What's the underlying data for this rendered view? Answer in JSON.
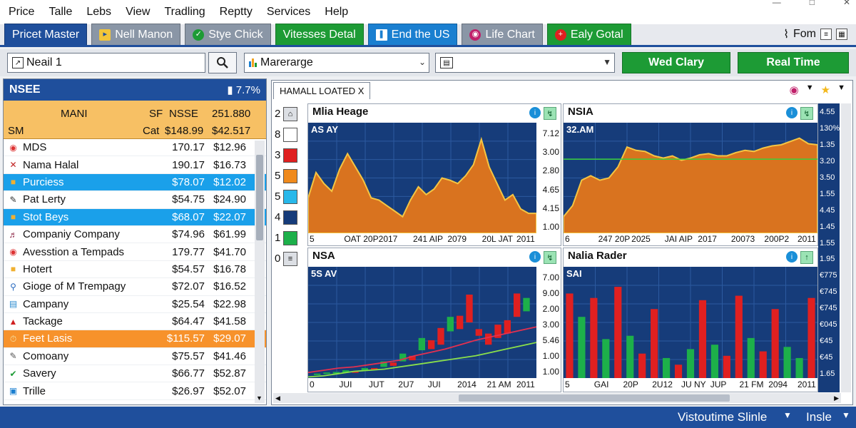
{
  "menu": [
    "Price",
    "Talle",
    "Lebs",
    "View",
    "Tradling",
    "Reptty",
    "Services",
    "Help"
  ],
  "tabs": [
    {
      "label": "Pricet Master",
      "style": "blue",
      "icon": ""
    },
    {
      "label": "Nell Manon",
      "style": "gray",
      "icon": "tag-icon"
    },
    {
      "label": "Stye Chick",
      "style": "gray",
      "icon": "check-circle-icon"
    },
    {
      "label": "Vitesses Detal",
      "style": "green",
      "icon": ""
    },
    {
      "label": "End the US",
      "style": "lblue",
      "icon": "columns-icon"
    },
    {
      "label": "Life Chart",
      "style": "gray",
      "icon": "globe-icon"
    },
    {
      "label": "Ealy Gotal",
      "style": "green",
      "icon": "plus-icon"
    }
  ],
  "tabbar_right": {
    "label": "Fom"
  },
  "toolbar": {
    "symbol_value": "Neail 1",
    "market_value": "Marerarge",
    "third_value": "",
    "btn1": "Wed Clary",
    "btn2": "Real Time"
  },
  "left_panel": {
    "title": "NSEE",
    "percent": "7.7%",
    "header1": {
      "name": "MANI",
      "c1": "SF",
      "c2": "NSSE",
      "c3": "251.880"
    },
    "header2": {
      "name": "SM",
      "c1": "Cat",
      "c2": "$148.99",
      "c3": "$42.517"
    },
    "rows": [
      {
        "name": "MDS",
        "v1": "170.17",
        "v2": "$12.96",
        "icon": "chrome-icon",
        "sel": ""
      },
      {
        "name": "Nama Halal",
        "v1": "190.17",
        "v2": "$16.73",
        "icon": "x-icon",
        "sel": ""
      },
      {
        "name": "Purciess",
        "v1": "$78.07",
        "v2": "$12.02",
        "icon": "folder-icon",
        "sel": "blue"
      },
      {
        "name": "Pat Lerty",
        "v1": "$54.75",
        "v2": "$24.90",
        "icon": "pencil-icon",
        "sel": ""
      },
      {
        "name": "Stot Beys",
        "v1": "$68.07",
        "v2": "$22.07",
        "icon": "folder-icon",
        "sel": "blue"
      },
      {
        "name": "Companiy Company",
        "v1": "$74.96",
        "v2": "$61.99",
        "icon": "music-icon",
        "sel": ""
      },
      {
        "name": "Avesstion a Tempads",
        "v1": "179.77",
        "v2": "$41.70",
        "icon": "chrome-icon",
        "sel": ""
      },
      {
        "name": "Hotert",
        "v1": "$54.57",
        "v2": "$16.78",
        "icon": "folder-icon",
        "sel": ""
      },
      {
        "name": "Gioge of M Trempagy",
        "v1": "$72.07",
        "v2": "$16.52",
        "icon": "search-icon",
        "sel": ""
      },
      {
        "name": "Campany",
        "v1": "$25.54",
        "v2": "$22.98",
        "icon": "document-icon",
        "sel": ""
      },
      {
        "name": "Tackage",
        "v1": "$64.47",
        "v2": "$41.58",
        "icon": "warning-icon",
        "sel": ""
      },
      {
        "name": "Feet Lasis",
        "v1": "$115.57",
        "v2": "$29.07",
        "icon": "clock-icon",
        "sel": "orange"
      },
      {
        "name": "Comoany",
        "v1": "$75.57",
        "v2": "$41.46",
        "icon": "edit-icon",
        "sel": ""
      },
      {
        "name": "Savery",
        "v1": "$66.77",
        "v2": "$52.87",
        "icon": "check-circle-icon",
        "sel": ""
      },
      {
        "name": "Trille",
        "v1": "$26.97",
        "v2": "$52.07",
        "icon": "image-icon",
        "sel": ""
      }
    ]
  },
  "right_panel": {
    "tab_label": "HAMALL LOATED X",
    "legend": [
      {
        "num": "2",
        "color": "#dcdfe4",
        "icon": "home-icon"
      },
      {
        "num": "8",
        "color": "#ffffff",
        "icon": ""
      },
      {
        "num": "3",
        "color": "#e02020",
        "icon": ""
      },
      {
        "num": "5",
        "color": "#f08a1c",
        "icon": ""
      },
      {
        "num": "5",
        "color": "#28b8ea",
        "icon": ""
      },
      {
        "num": "4",
        "color": "#163c7a",
        "icon": ""
      },
      {
        "num": "1",
        "color": "#1db04a",
        "icon": ""
      },
      {
        "num": "0",
        "color": "#dcdfe4",
        "icon": "list-icon"
      }
    ],
    "right_axis": [
      "4.55",
      "130%",
      "1.35",
      "3.20",
      "3.50",
      "1.55",
      "4.45",
      "1.45",
      "1.55",
      "1.95",
      "€775",
      "€745",
      "€745",
      "€045",
      "€45",
      "€45",
      "1.65"
    ]
  },
  "chart_data": [
    {
      "type": "area",
      "title": "Mlia Heage",
      "subtitle": "AS AY",
      "x_ticks": [
        "5",
        "OAT 20P",
        "2017",
        "241 AIP",
        "2079",
        "20L JAT",
        "2011"
      ],
      "y_ticks": [
        "7.12",
        "3.00",
        "2.80",
        "4.65",
        "4.15",
        "1.00"
      ],
      "ylim": [
        0,
        10
      ],
      "values": [
        3.2,
        5.5,
        4.5,
        3.8,
        5.8,
        7.2,
        6.0,
        4.8,
        3.2,
        3.0,
        2.5,
        2.0,
        1.5,
        3.0,
        4.2,
        3.5,
        4.0,
        5.0,
        4.8,
        4.5,
        5.2,
        6.2,
        8.5,
        6.0,
        4.5,
        3.0,
        3.5,
        2.2,
        1.8,
        1.8
      ],
      "color": "#d9731f"
    },
    {
      "type": "area",
      "title": "NSIA",
      "subtitle": "32.AM",
      "x_ticks": [
        "6",
        "247 20P",
        "2025",
        "JAI AIP",
        "2017",
        "20073",
        "200P2",
        "2011"
      ],
      "ref_line": 6.7,
      "ylim": [
        0,
        10
      ],
      "values": [
        1.5,
        2.5,
        4.8,
        5.2,
        4.8,
        5.0,
        6.0,
        7.8,
        7.5,
        7.4,
        7.0,
        6.8,
        7.0,
        6.6,
        6.8,
        7.1,
        7.2,
        7.0,
        7.0,
        7.3,
        7.5,
        7.4,
        7.7,
        7.9,
        8.0,
        8.3,
        8.6,
        8.1,
        8.0
      ],
      "color": "#d9731f"
    },
    {
      "type": "candlestick",
      "title": "NSA",
      "subtitle": "5S AV",
      "x_ticks": [
        "0",
        "JUI",
        "JUT",
        "2U7",
        "JUI",
        "2014",
        "21 AM",
        "2011"
      ],
      "y_ticks": [
        "7.00",
        "9.00",
        "2.00",
        "3.00",
        "5.46",
        "1.00",
        "1.00"
      ],
      "ylim": [
        0,
        10
      ],
      "candles": [
        [
          0.3,
          0.4
        ],
        [
          0.4,
          0.5
        ],
        [
          0.4,
          0.55
        ],
        [
          0.5,
          0.7
        ],
        [
          0.6,
          0.5
        ],
        [
          0.7,
          0.9
        ],
        [
          0.9,
          0.8
        ],
        [
          1.0,
          1.5
        ],
        [
          1.4,
          1.1
        ],
        [
          1.5,
          2.2
        ],
        [
          2.0,
          1.6
        ],
        [
          2.5,
          3.6
        ],
        [
          3.4,
          2.6
        ],
        [
          4.5,
          3.0
        ],
        [
          4.2,
          5.5
        ],
        [
          5.6,
          4.4
        ],
        [
          7.5,
          5.0
        ],
        [
          4.4,
          3.8
        ],
        [
          4.0,
          3.0
        ],
        [
          4.8,
          3.6
        ],
        [
          5.2,
          4.0
        ],
        [
          7.6,
          5.5
        ],
        [
          6.0,
          7.2
        ]
      ],
      "line_red": [
        0.5,
        0.7,
        0.9,
        1.0,
        1.2,
        1.4,
        1.6,
        2.0,
        2.3,
        2.6,
        3.0,
        3.4,
        3.7,
        4.0,
        4.3,
        4.6
      ],
      "line_green": [
        0.1,
        0.2,
        0.4,
        0.6,
        0.7,
        0.8,
        1.0,
        1.2,
        1.4,
        1.6,
        1.8,
        2.0,
        2.3,
        2.6,
        2.9,
        3.2
      ]
    },
    {
      "type": "bar",
      "title": "Nalia Rader",
      "subtitle": "SAI",
      "x_ticks": [
        "5",
        "GAI",
        "20P",
        "2U12",
        "JU NY",
        "JUP",
        "21 FM",
        "2094",
        "2011"
      ],
      "ylim": [
        0,
        10
      ],
      "bars": [
        {
          "v": 7.6,
          "c": "#e02020"
        },
        {
          "v": 5.5,
          "c": "#1db04a"
        },
        {
          "v": 7.2,
          "c": "#e02020"
        },
        {
          "v": 3.5,
          "c": "#1db04a"
        },
        {
          "v": 8.2,
          "c": "#e02020"
        },
        {
          "v": 3.8,
          "c": "#1db04a"
        },
        {
          "v": 2.2,
          "c": "#e02020"
        },
        {
          "v": 6.2,
          "c": "#e02020"
        },
        {
          "v": 1.8,
          "c": "#1db04a"
        },
        {
          "v": 1.2,
          "c": "#e02020"
        },
        {
          "v": 2.6,
          "c": "#1db04a"
        },
        {
          "v": 7.0,
          "c": "#e02020"
        },
        {
          "v": 3.0,
          "c": "#1db04a"
        },
        {
          "v": 2.0,
          "c": "#e02020"
        },
        {
          "v": 7.4,
          "c": "#e02020"
        },
        {
          "v": 3.6,
          "c": "#1db04a"
        },
        {
          "v": 2.4,
          "c": "#e02020"
        },
        {
          "v": 6.2,
          "c": "#e02020"
        },
        {
          "v": 2.8,
          "c": "#1db04a"
        },
        {
          "v": 1.8,
          "c": "#1db04a"
        },
        {
          "v": 7.2,
          "c": "#e02020"
        }
      ]
    }
  ],
  "status": {
    "text": "Vistoutime Slinle",
    "mode": "Insle"
  }
}
